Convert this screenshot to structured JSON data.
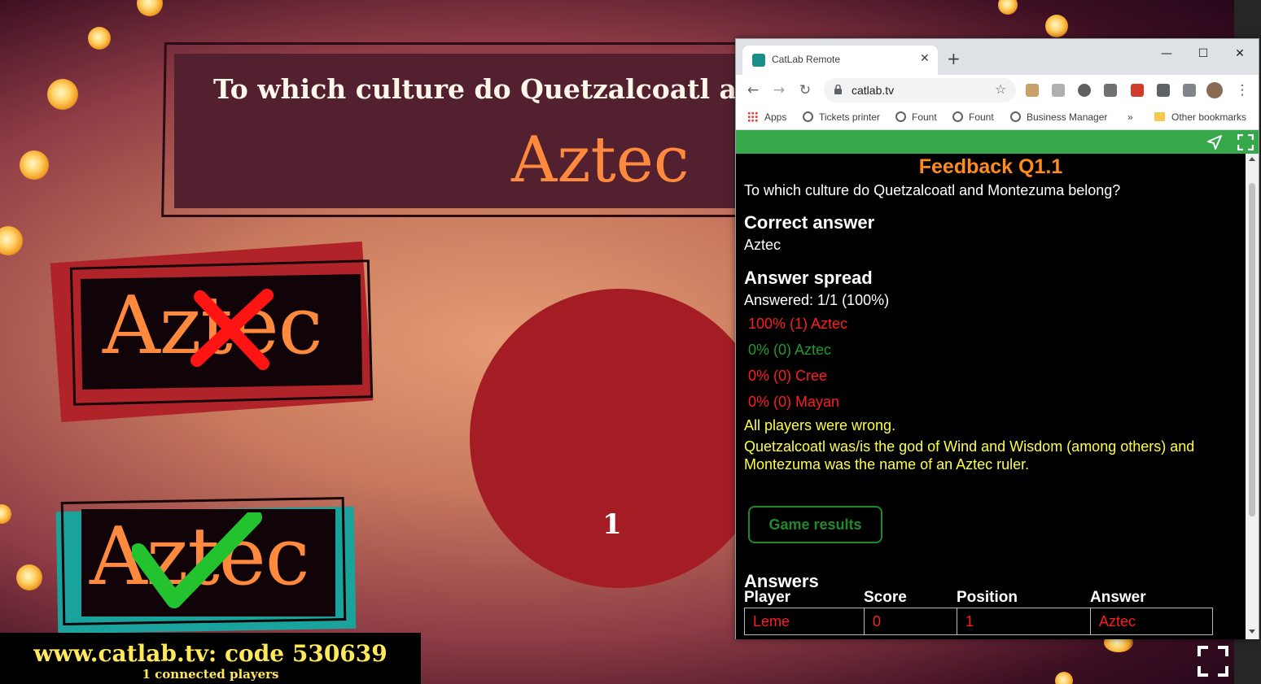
{
  "stage": {
    "question": "To which culture do Quetzalcoatl and M",
    "answer_display": "Aztec",
    "wrong_card_word": "Aztec",
    "right_card_word": "Aztec",
    "answer_count": "1",
    "url_code": "www.catlab.tv: code 530639",
    "players": "1 connected players"
  },
  "browser": {
    "tab_title": "CatLab Remote",
    "url": "catlab.tv",
    "bookmarks": [
      "Apps",
      "Tickets printer",
      "Fount",
      "Fount",
      "Business Manager",
      "»",
      "Other bookmarks"
    ]
  },
  "feedback": {
    "title": "Feedback Q1.1",
    "question": "To which culture do Quetzalcoatl and Montezuma belong?",
    "correct_heading": "Correct answer",
    "correct_answer": "Aztec",
    "spread_heading": "Answer spread",
    "answered": "Answered: 1/1 (100%)",
    "spread": [
      {
        "text": "100% (1) Aztec",
        "color": "#ff1d1d"
      },
      {
        "text": "0% (0) Aztec",
        "color": "#1f9a2c"
      },
      {
        "text": "0% (0) Cree",
        "color": "#ff1d1d"
      },
      {
        "text": "0% (0) Mayan",
        "color": "#ff1d1d"
      }
    ],
    "all_wrong": "All players were wrong.",
    "explanation": "Quetzalcoatl was/is the god of Wind and Wisdom (among others) and Montezuma was the name of an Aztec ruler.",
    "game_results_button": "Game results",
    "answers_heading": "Answers",
    "table": {
      "headers": [
        "Player",
        "Score",
        "Position",
        "Answer"
      ],
      "rows": [
        [
          "Leme",
          "0",
          "1",
          "Aztec"
        ]
      ]
    }
  },
  "colors": {
    "green_bar": "#36a84a",
    "feedback_title": "#ff8a1e",
    "wrong": "#ff1d1d",
    "right": "#1f9a2c",
    "note": "#ffff40"
  }
}
